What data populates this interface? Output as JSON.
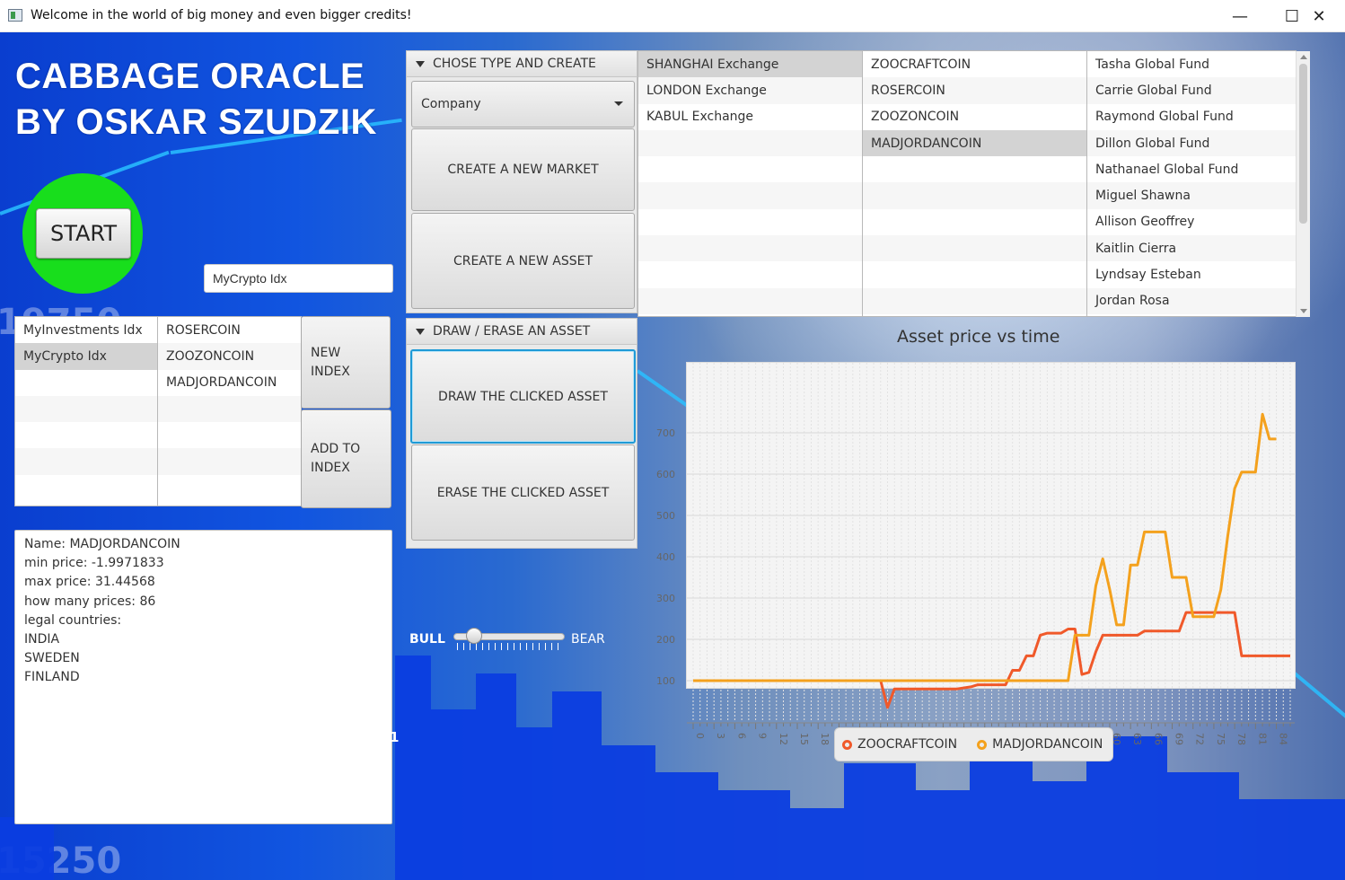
{
  "window": {
    "title": "Welcome in the world of big money and even bigger credits!"
  },
  "header": {
    "line1": "CABBAGE ORACLE",
    "line2": "BY OSKAR SZUDZIK"
  },
  "start_button": "START",
  "index_input": {
    "value": "MyCrypto Idx"
  },
  "indexes": [
    "MyInvestments Idx",
    "MyCrypto Idx"
  ],
  "index_members": [
    "ROSERCOIN",
    "ZOOZONCOIN",
    "MADJORDANCOIN"
  ],
  "index_buttons": {
    "new_index": [
      "NEW",
      "INDEX"
    ],
    "add_to_index": [
      "ADD TO",
      "INDEX"
    ]
  },
  "info": {
    "name": "Name: MADJORDANCOIN",
    "min_price": "min price: -1.9971833",
    "max_price": "max price: 31.44568",
    "count": "how many prices: 86",
    "legal_header": "legal countries:",
    "countries": [
      "INDIA",
      "SWEDEN",
      "FINLAND"
    ]
  },
  "create_panel": {
    "title": "CHOSE TYPE AND CREATE",
    "type_select": "Company",
    "new_market": "CREATE A NEW MARKET",
    "new_asset": "CREATE A NEW ASSET"
  },
  "draw_panel": {
    "title": "DRAW / ERASE AN ASSET",
    "draw": "DRAW THE CLICKED ASSET",
    "erase": "ERASE THE CLICKED ASSET"
  },
  "slider": {
    "left": "BULL",
    "right": "BEAR",
    "value": 0.12
  },
  "markets": [
    "SHANGHAI Exchange",
    "LONDON Exchange",
    "KABUL Exchange"
  ],
  "assets": [
    "ZOOCRAFTCOIN",
    "ROSERCOIN",
    "ZOOZONCOIN",
    "MADJORDANCOIN"
  ],
  "investors": [
    "Tasha  Global Fund",
    "Carrie  Global Fund",
    "Raymond  Global Fund",
    "Dillon  Global Fund",
    "Nathanael  Global Fund",
    "Miguel Shawna",
    "Allison Geoffrey",
    "Kaitlin Cierra",
    "Lyndsay Esteban",
    "Jordan Rosa"
  ],
  "stray_text": "1",
  "colors": {
    "zoocraft": "#f0592a",
    "madjordan": "#f4a11d",
    "start_green": "#18de1c"
  },
  "chart_data": {
    "type": "line",
    "title": "Asset price vs time",
    "ylim": [
      0,
      800
    ],
    "yticks": [
      100,
      200,
      300,
      400,
      500,
      600,
      700
    ],
    "xticks": [
      "0",
      "3",
      "6",
      "9",
      "12",
      "15",
      "18",
      "21",
      "24",
      "27",
      "30",
      "33",
      "36",
      "39",
      "42",
      "45",
      "48",
      "51",
      "54",
      "57",
      "60",
      "63",
      "66",
      "69",
      "72",
      "75",
      "78",
      "81",
      "84"
    ],
    "xlim": [
      0,
      86
    ],
    "series": [
      {
        "name": "ZOOCRAFTCOIN",
        "color": "#f0592a",
        "points": [
          [
            0,
            100
          ],
          [
            27,
            100
          ],
          [
            28,
            35
          ],
          [
            29,
            80
          ],
          [
            30,
            80
          ],
          [
            34,
            80
          ],
          [
            38,
            80
          ],
          [
            40,
            85
          ],
          [
            41,
            90
          ],
          [
            45,
            90
          ],
          [
            46,
            125
          ],
          [
            47,
            125
          ],
          [
            48,
            160
          ],
          [
            49,
            160
          ],
          [
            50,
            210
          ],
          [
            51,
            215
          ],
          [
            53,
            215
          ],
          [
            54,
            225
          ],
          [
            55,
            225
          ],
          [
            56,
            115
          ],
          [
            57,
            120
          ],
          [
            58,
            170
          ],
          [
            59,
            210
          ],
          [
            64,
            210
          ],
          [
            65,
            220
          ],
          [
            70,
            220
          ],
          [
            71,
            265
          ],
          [
            78,
            265
          ],
          [
            79,
            160
          ],
          [
            86,
            160
          ]
        ]
      },
      {
        "name": "MADJORDANCOIN",
        "color": "#f4a11d",
        "points": [
          [
            0,
            100
          ],
          [
            54,
            100
          ],
          [
            55,
            210
          ],
          [
            57,
            210
          ],
          [
            58,
            330
          ],
          [
            59,
            395
          ],
          [
            60,
            320
          ],
          [
            61,
            235
          ],
          [
            62,
            235
          ],
          [
            63,
            380
          ],
          [
            64,
            380
          ],
          [
            65,
            460
          ],
          [
            66,
            460
          ],
          [
            68,
            460
          ],
          [
            69,
            350
          ],
          [
            71,
            350
          ],
          [
            72,
            255
          ],
          [
            75,
            255
          ],
          [
            76,
            320
          ],
          [
            77,
            450
          ],
          [
            78,
            565
          ],
          [
            79,
            605
          ],
          [
            81,
            605
          ],
          [
            82,
            745
          ],
          [
            83,
            685
          ],
          [
            84,
            685
          ]
        ]
      }
    ]
  }
}
